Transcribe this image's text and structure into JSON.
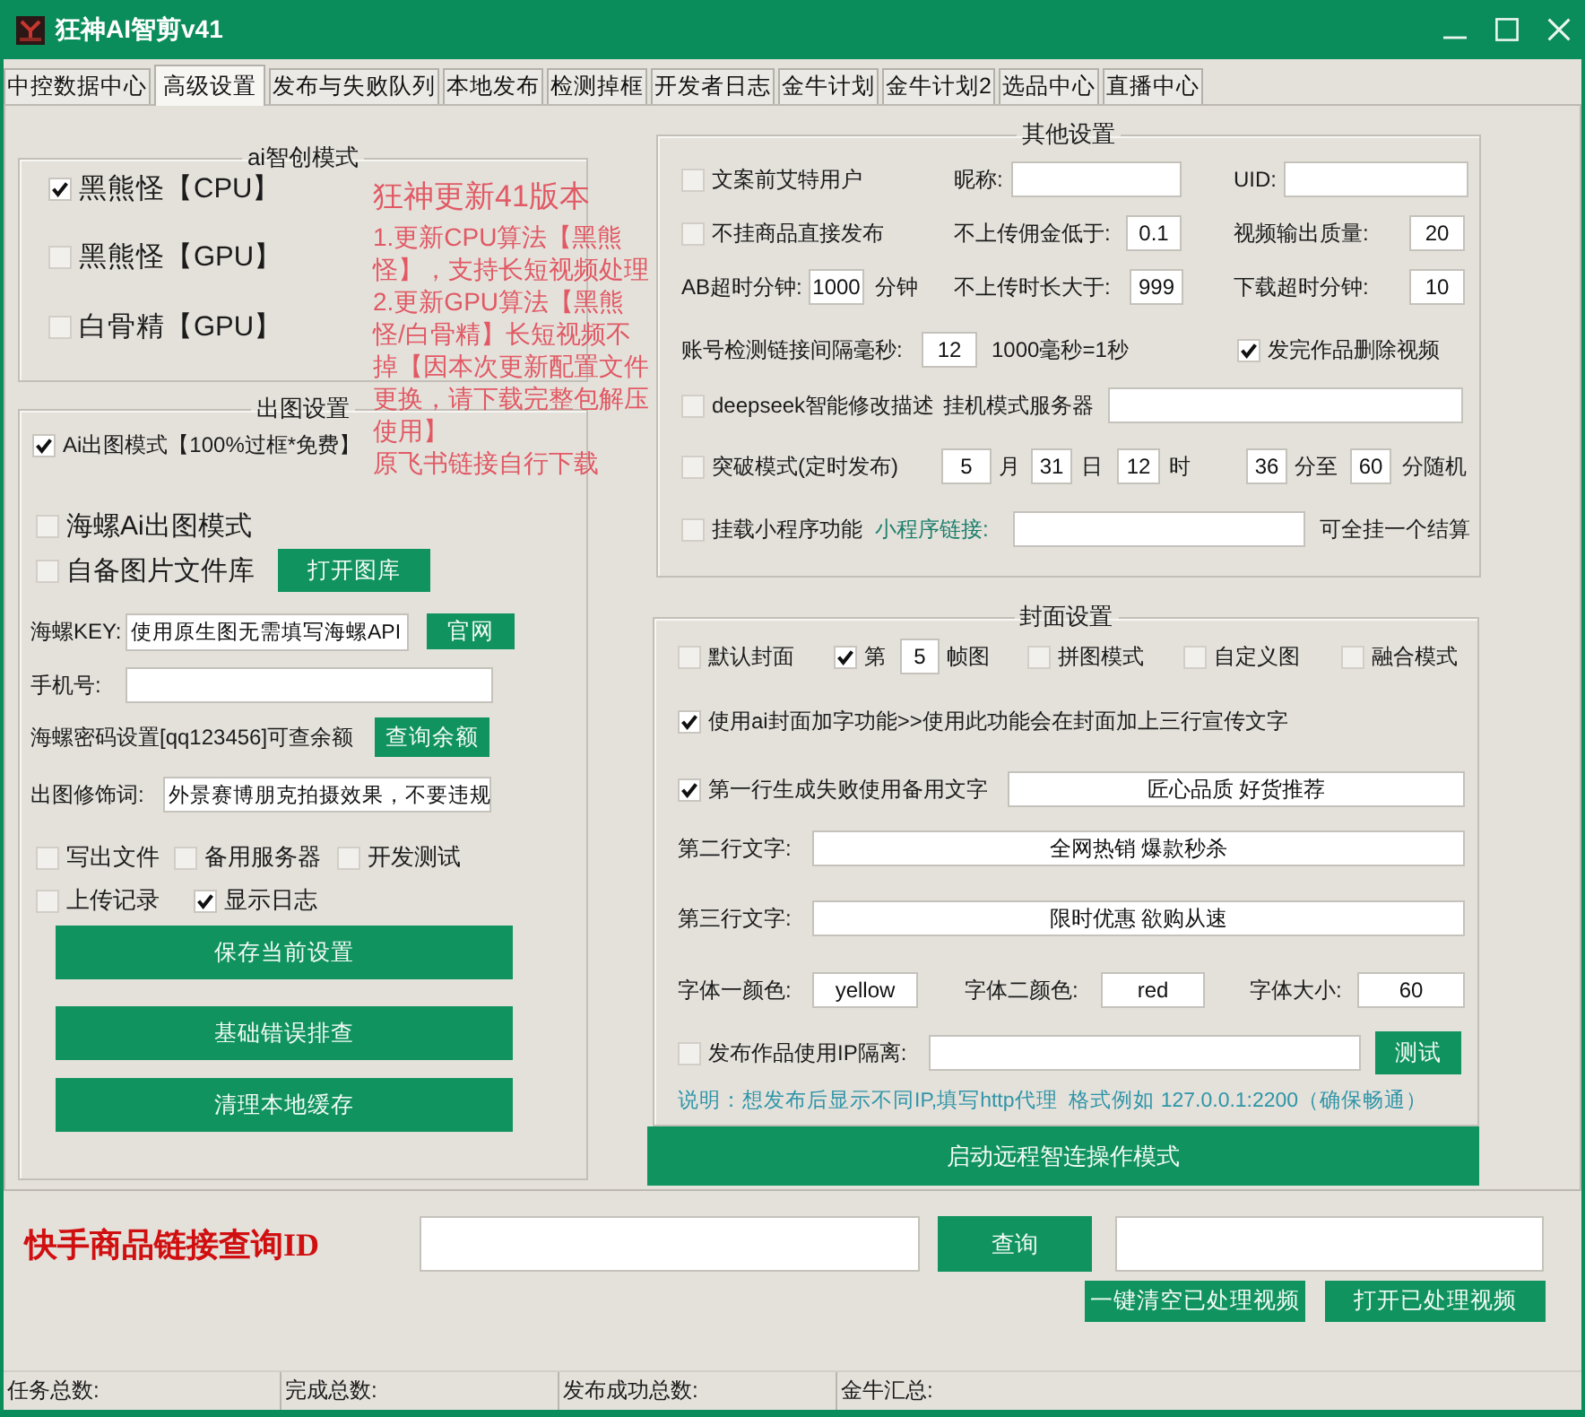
{
  "window": {
    "title": "狂神AI智剪v41"
  },
  "tabs": [
    {
      "label": "中控数据中心",
      "selected": false
    },
    {
      "label": "高级设置",
      "selected": true
    },
    {
      "label": "发布与失败队列",
      "selected": false
    },
    {
      "label": "本地发布",
      "selected": false
    },
    {
      "label": "检测掉框",
      "selected": false
    },
    {
      "label": "开发者日志",
      "selected": false
    },
    {
      "label": "金牛计划",
      "selected": false
    },
    {
      "label": "金牛计划2",
      "selected": false
    },
    {
      "label": "选品中心",
      "selected": false
    },
    {
      "label": "直播中心",
      "selected": false
    }
  ],
  "announcement": {
    "heading": "狂神更新41版本",
    "items": [
      "1.更新CPU算法【黑熊怪】，支持长短视频处理",
      "2.更新GPU算法【黑熊怪/白骨精】长短视频不掉【因本次更新配置文件更换，请下载完整包解压使用】",
      "原飞书链接自行下载"
    ]
  },
  "ai_mode": {
    "title": "ai智创模式",
    "rows": [
      {
        "items": [
          {
            "kind": "checkbox",
            "label": "黑熊怪【CPU】",
            "checked": true
          }
        ]
      },
      {
        "items": [
          {
            "kind": "checkbox",
            "label": "黑熊怪【GPU】",
            "checked": false
          }
        ]
      },
      {
        "items": [
          {
            "kind": "checkbox",
            "label": "白骨精【GPU】",
            "checked": false
          }
        ]
      }
    ]
  },
  "image_settings": {
    "title": "出图设置",
    "rows": [
      {
        "items": [
          {
            "kind": "checkbox",
            "label": "Ai出图模式【100%过框*免费】",
            "checked": true
          }
        ]
      },
      {
        "items": [
          {
            "kind": "checkbox",
            "label": "海螺Ai出图模式",
            "checked": false
          }
        ]
      },
      {
        "items": [
          {
            "kind": "checkbox",
            "label": "自备图片文件库",
            "checked": false
          },
          {
            "kind": "button",
            "label": "打开图库"
          }
        ]
      },
      {
        "items": [
          {
            "kind": "label",
            "text": "海螺KEY:"
          },
          {
            "kind": "field",
            "value": "使用原生图无需填写海螺API"
          },
          {
            "kind": "button",
            "label": "官网"
          }
        ]
      },
      {
        "items": [
          {
            "kind": "label",
            "text": "手机号:"
          },
          {
            "kind": "field"
          }
        ]
      },
      {
        "items": [
          {
            "kind": "label",
            "text": "海螺密码设置[qq123456]可查余额"
          },
          {
            "kind": "button",
            "label": "查询余额"
          }
        ]
      },
      {
        "items": [
          {
            "kind": "label",
            "text": "出图修饰词:"
          },
          {
            "kind": "field",
            "value": "外景赛博朋克拍摄效果，不要违规"
          }
        ]
      },
      {
        "items": [
          {
            "kind": "checkbox",
            "label": "写出文件",
            "checked": false
          },
          {
            "kind": "checkbox",
            "label": "备用服务器",
            "checked": false
          },
          {
            "kind": "checkbox",
            "label": "开发测试",
            "checked": false
          }
        ]
      },
      {
        "items": [
          {
            "kind": "checkbox",
            "label": "上传记录",
            "checked": false
          },
          {
            "kind": "checkbox",
            "label": "显示日志",
            "checked": true
          }
        ]
      },
      {
        "items": [
          {
            "kind": "button",
            "label": "保存当前设置"
          }
        ]
      },
      {
        "items": [
          {
            "kind": "button",
            "label": "基础错误排查"
          }
        ]
      },
      {
        "items": [
          {
            "kind": "button",
            "label": "清理本地缓存"
          }
        ]
      }
    ]
  },
  "other_settings": {
    "title": "其他设置",
    "rows": [
      {
        "items": [
          {
            "kind": "checkbox",
            "label": "文案前艾特用户",
            "checked": false
          },
          {
            "kind": "label",
            "text": "昵称:"
          },
          {
            "kind": "field"
          },
          {
            "kind": "label",
            "text": "UID:"
          },
          {
            "kind": "field"
          }
        ]
      },
      {
        "items": [
          {
            "kind": "checkbox",
            "label": "不挂商品直接发布",
            "checked": false
          },
          {
            "kind": "label",
            "text": "不上传佣金低于:"
          },
          {
            "kind": "field",
            "value": "0.1"
          },
          {
            "kind": "label",
            "text": "视频输出质量:"
          },
          {
            "kind": "field",
            "value": "20"
          }
        ]
      },
      {
        "items": [
          {
            "kind": "label",
            "text": "AB超时分钟:"
          },
          {
            "kind": "field",
            "value": "1000"
          },
          {
            "kind": "label",
            "text": "分钟"
          },
          {
            "kind": "label",
            "text": "不上传时长大于:"
          },
          {
            "kind": "field",
            "value": "999"
          },
          {
            "kind": "label",
            "text": "下载超时分钟:"
          },
          {
            "kind": "field",
            "value": "10"
          }
        ]
      },
      {
        "items": [
          {
            "kind": "label",
            "text": "账号检测链接间隔毫秒:"
          },
          {
            "kind": "field",
            "value": "12"
          },
          {
            "kind": "label",
            "text": "1000毫秒=1秒"
          },
          {
            "kind": "checkbox",
            "label": "发完作品删除视频",
            "checked": true
          }
        ]
      },
      {
        "items": [
          {
            "kind": "checkbox",
            "label": "deepseek智能修改描述",
            "checked": false
          },
          {
            "kind": "label",
            "text": "挂机模式服务器"
          },
          {
            "kind": "field"
          }
        ]
      },
      {
        "items": [
          {
            "kind": "checkbox",
            "label": "突破模式(定时发布)",
            "checked": false
          },
          {
            "kind": "field",
            "value": "5"
          },
          {
            "kind": "label",
            "text": "月"
          },
          {
            "kind": "field",
            "value": "31"
          },
          {
            "kind": "label",
            "text": "日"
          },
          {
            "kind": "field",
            "value": "12"
          },
          {
            "kind": "label",
            "text": "时"
          },
          {
            "kind": "field",
            "value": "36"
          },
          {
            "kind": "label",
            "text": "分至"
          },
          {
            "kind": "field",
            "value": "60"
          },
          {
            "kind": "label",
            "text": "分随机"
          }
        ]
      },
      {
        "items": [
          {
            "kind": "checkbox",
            "label": "挂载小程序功能",
            "checked": false
          },
          {
            "kind": "link",
            "text": "小程序链接:"
          },
          {
            "kind": "field"
          },
          {
            "kind": "label",
            "text": "可全挂一个结算"
          }
        ]
      }
    ]
  },
  "cover_settings": {
    "title": "封面设置",
    "rows": [
      {
        "items": [
          {
            "kind": "checkbox",
            "label": "默认封面",
            "checked": false
          },
          {
            "kind": "checkbox",
            "label": "第",
            "checked": true
          },
          {
            "kind": "field",
            "value": "5"
          },
          {
            "kind": "label",
            "text": "帧图"
          },
          {
            "kind": "checkbox",
            "label": "拼图模式",
            "checked": false
          },
          {
            "kind": "checkbox",
            "label": "自定义图",
            "checked": false
          },
          {
            "kind": "checkbox",
            "label": "融合模式",
            "checked": false
          }
        ]
      },
      {
        "items": [
          {
            "kind": "checkbox",
            "label": "使用ai封面加字功能>>使用此功能会在封面加上三行宣传文字",
            "checked": true
          }
        ]
      },
      {
        "items": [
          {
            "kind": "checkbox",
            "label": "第一行生成失败使用备用文字",
            "checked": true
          },
          {
            "kind": "field",
            "value": "匠心品质 好货推荐"
          }
        ]
      },
      {
        "items": [
          {
            "kind": "label",
            "text": "第二行文字:"
          },
          {
            "kind": "field",
            "value": "全网热销 爆款秒杀"
          }
        ]
      },
      {
        "items": [
          {
            "kind": "label",
            "text": "第三行文字:"
          },
          {
            "kind": "field",
            "value": "限时优惠 欲购从速"
          }
        ]
      },
      {
        "items": [
          {
            "kind": "label",
            "text": "字体一颜色:"
          },
          {
            "kind": "field",
            "value": "yellow"
          },
          {
            "kind": "label",
            "text": "字体二颜色:"
          },
          {
            "kind": "field",
            "value": "red"
          },
          {
            "kind": "label",
            "text": "字体大小:"
          },
          {
            "kind": "field",
            "value": "60"
          }
        ]
      },
      {
        "items": [
          {
            "kind": "checkbox",
            "label": "发布作品使用IP隔离:",
            "checked": false
          },
          {
            "kind": "field"
          },
          {
            "kind": "button",
            "label": "测试"
          }
        ]
      },
      {
        "items": [
          {
            "kind": "note",
            "text": "说明：想发布后显示不同IP,填写http代理  格式例如 127.0.0.1:2200（确保畅通）"
          }
        ]
      }
    ]
  },
  "remote_mode_button": {
    "label": "启动远程智连操作模式"
  },
  "lookup": {
    "title": "快手商品链接查询ID",
    "query_button": "查询",
    "buttons": [
      "一键清空已处理视频",
      "打开已处理视频"
    ]
  },
  "status_bar": [
    "任务总数:",
    "完成总数:",
    "发布成功总数:",
    "金牛汇总:"
  ]
}
